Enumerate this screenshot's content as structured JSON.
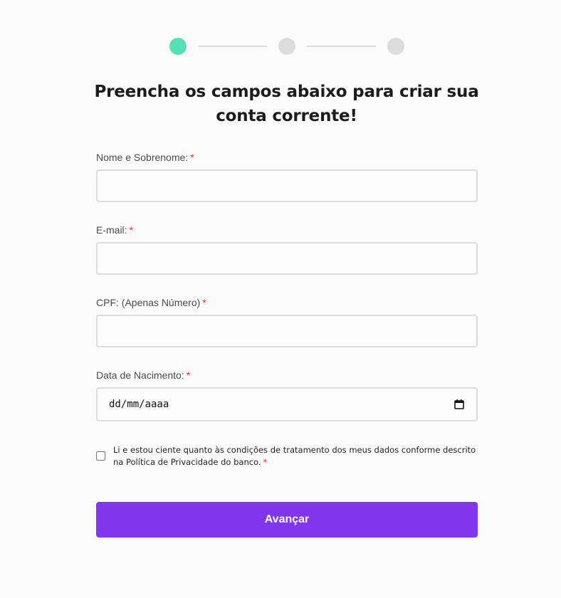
{
  "colors": {
    "step_active": "#57e0b5",
    "step_inactive": "#dcdcdc",
    "primary_button": "#8236ec",
    "required": "#e0303a"
  },
  "stepper": {
    "steps": [
      {
        "state": "active"
      },
      {
        "state": "inactive"
      },
      {
        "state": "inactive"
      }
    ]
  },
  "title": {
    "line1": "Preencha os campos abaixo para criar sua",
    "line2": "conta corrente!"
  },
  "form": {
    "required_mark": "*",
    "name": {
      "label": "Nome e Sobrenome:",
      "value": ""
    },
    "email": {
      "label": "E-mail:",
      "value": ""
    },
    "cpf": {
      "label": "CPF: (Apenas Número)",
      "value": ""
    },
    "birthdate": {
      "label": "Data de Nacimento:",
      "placeholder": "dd/mm/aaaa",
      "icon": "calendar-icon"
    },
    "consent": {
      "text": "Li e estou ciente quanto às condições de tratamento dos meus dados conforme descrito na Política de Privacidade do banco.",
      "checked": false
    },
    "submit_label": "Avançar"
  }
}
